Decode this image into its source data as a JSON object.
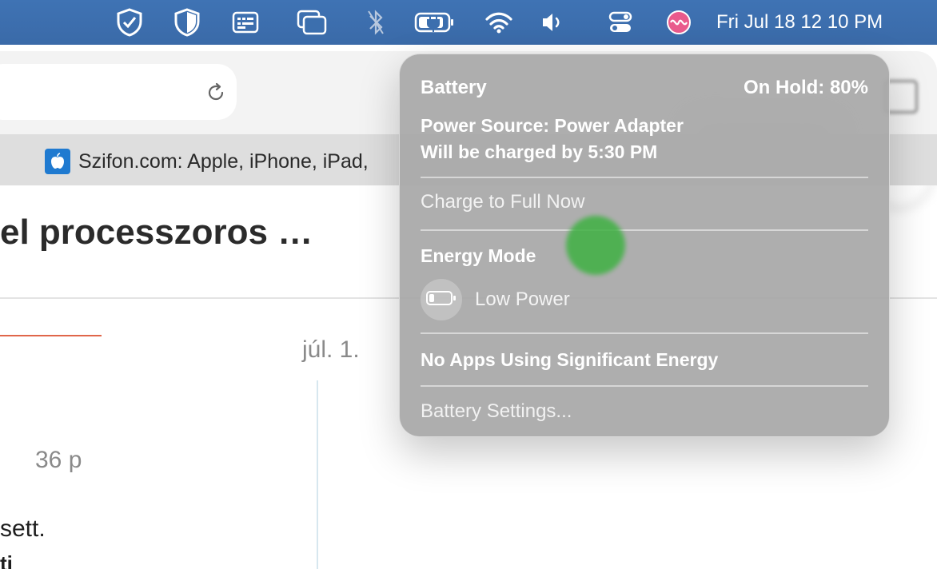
{
  "menubar": {
    "clock": "Fri Jul 18  12 10 PM",
    "icons": [
      "shield-check-icon",
      "shield-icon",
      "keyboard-icon",
      "windows-icon",
      "bluetooth-icon",
      "battery-charging-icon",
      "wifi-icon",
      "volume-icon",
      "control-center-icon",
      "siri-icon"
    ]
  },
  "browser": {
    "tab_title": "Szifon.com: Apple, iPhone, iPad,",
    "article_title": "el processzoros …",
    "date": "júl. 1.",
    "meta": "36 p",
    "body_line1": "sett.",
    "body_line2": "ti"
  },
  "battery_popover": {
    "title": "Battery",
    "status": "On Hold: 80%",
    "power_source": "Power Source: Power Adapter",
    "charge_eta": "Will be charged by 5:30 PM",
    "charge_full": "Charge to Full Now",
    "energy_mode_header": "Energy Mode",
    "low_power": "Low Power",
    "apps_status": "No Apps Using Significant Energy",
    "settings": "Battery Settings..."
  }
}
